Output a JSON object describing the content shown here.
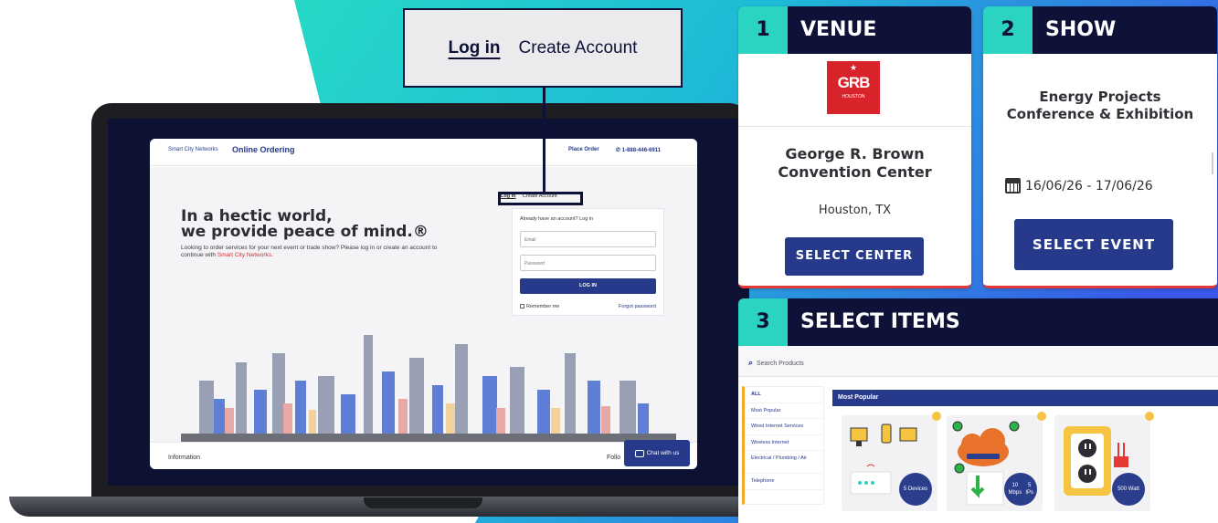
{
  "callout": {
    "login": "Log in",
    "create": "Create Account"
  },
  "site": {
    "brand_small": "Smart City Networks",
    "brand_online": "Online Ordering",
    "place_order": "Place Order",
    "phone": "1-888-446-6911",
    "hero_line1": "In a hectic world,",
    "hero_line2": "we provide peace of mind.®",
    "hero_sub_pre": "Looking to order services for your next event or trade show? Please log in or create an account to continue with ",
    "hero_sub_link": "Smart City Networks",
    "hero_sub_post": ".",
    "tab_login": "Log in",
    "tab_create": "Create Account",
    "login_prompt": "Already have an account? Log in",
    "email_placeholder": "Email",
    "password_placeholder": "Password",
    "login_button": "LOG IN",
    "remember": "Remember me",
    "forgot": "Forgot password",
    "footer_info": "Information",
    "footer_follow": "Follo",
    "chat": "Chat with us"
  },
  "steps": {
    "venue": {
      "number": "1",
      "title": "VENUE",
      "logo_text": "GRB",
      "logo_sub": "HOUSTON",
      "name": "George R. Brown Convention Center",
      "city": "Houston, TX",
      "button": "SELECT CENTER"
    },
    "show": {
      "number": "2",
      "title": "SHOW",
      "name_line1": "Energy Projects",
      "name_line2": "Conference & Exhibition",
      "dates": "16/06/26 - 17/06/26",
      "button": "SELECT EVENT"
    },
    "items": {
      "number": "3",
      "title": "SELECT ITEMS",
      "search_placeholder": "Search Products",
      "categories": [
        "ALL",
        "Most Popular",
        "Wired Internet Services",
        "Wireless Internet",
        "Electrical / Plumbing / Air",
        "Telephone"
      ],
      "popular_header": "Most Popular",
      "products": [
        {
          "badge_line1": "5",
          "badge_line2": "Devices"
        },
        {
          "badge_line1": "10 Mbps",
          "badge_line2": "5 IPs"
        },
        {
          "badge_line1": "500",
          "badge_line2": "Watt"
        }
      ]
    }
  },
  "colors": {
    "navy": "#0e1238",
    "brand_blue": "#26398a",
    "teal": "#2bd3c1",
    "accent_red": "#e53935",
    "grb_red": "#d8232a"
  }
}
